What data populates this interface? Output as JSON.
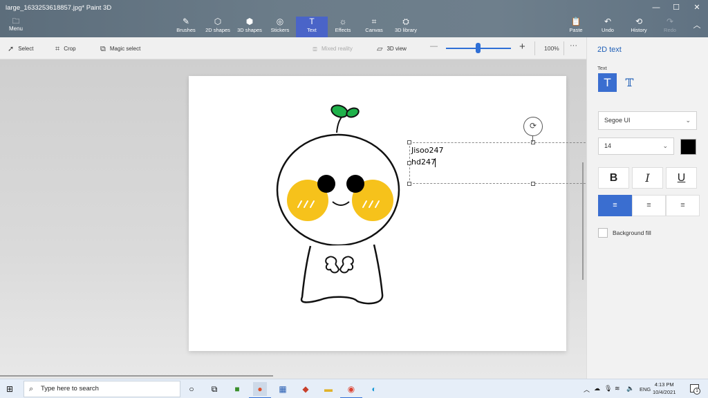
{
  "window": {
    "title": "large_1633253618857.jpg*   Paint 3D",
    "minimize": "—",
    "maximize": "☐",
    "close": "✕"
  },
  "ribbon": {
    "menu": {
      "label": "Menu",
      "icon": "folder-icon"
    },
    "tools": [
      {
        "label": "Brushes",
        "icon": "brush-icon"
      },
      {
        "label": "2D shapes",
        "icon": "2d-shapes-icon"
      },
      {
        "label": "3D shapes",
        "icon": "3d-shapes-icon"
      },
      {
        "label": "Stickers",
        "icon": "stickers-icon"
      },
      {
        "label": "Text",
        "icon": "text-icon"
      },
      {
        "label": "Effects",
        "icon": "effects-icon"
      },
      {
        "label": "Canvas",
        "icon": "canvas-icon"
      },
      {
        "label": "3D library",
        "icon": "3d-library-icon"
      }
    ],
    "actions": [
      {
        "label": "Paste",
        "icon": "paste-icon"
      },
      {
        "label": "Undo",
        "icon": "undo-icon"
      },
      {
        "label": "History",
        "icon": "history-icon"
      },
      {
        "label": "Redo",
        "icon": "redo-icon"
      }
    ],
    "active_tool": "Text",
    "accent": "#4a64c8"
  },
  "toolbar": {
    "select": "Select",
    "crop": "Crop",
    "magic_select": "Magic select",
    "mixed_reality": "Mixed reality",
    "view_3d": "3D view",
    "zoom_minus": "—",
    "zoom_plus": "+",
    "zoom_percent": "100%",
    "zoom_level": 0.47,
    "more": "···"
  },
  "canvas": {
    "text_lines": [
      "Jisoo247",
      "hd247"
    ],
    "drawing": "cartoon sprout character with yellow cheeks"
  },
  "panel": {
    "title": "2D text",
    "text_label": "Text",
    "font_family": "Segoe UI",
    "font_size": "14",
    "text_color": "#000000",
    "bold": "B",
    "italic": "I",
    "underline": "U",
    "alignment": "left",
    "background_fill_label": "Background fill",
    "background_fill_checked": false
  },
  "taskbar": {
    "search_placeholder": "Type here to search",
    "language": "ENG",
    "time": "4:13 PM",
    "date": "10/4/2021",
    "notification_count": "1"
  }
}
